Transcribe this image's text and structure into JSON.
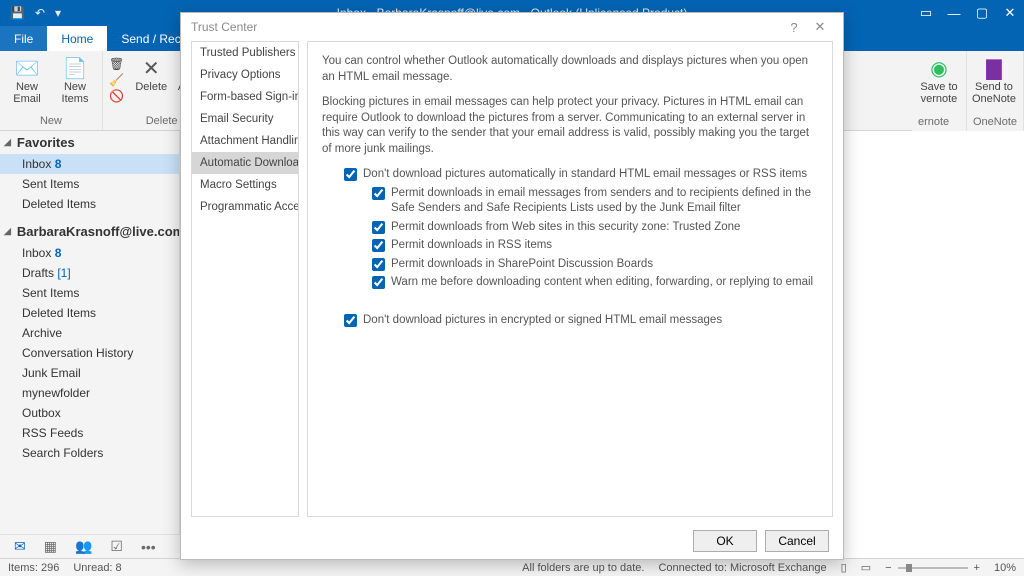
{
  "titlebar": {
    "title": "Inbox - BarbaraKrasnoff@live.com - Outlook (Unlicensed Product)"
  },
  "tabs": {
    "file": "File",
    "home": "Home",
    "sendreceive": "Send / Receive"
  },
  "ribbon": {
    "new_email": "New\nEmail",
    "new_items": "New\nItems",
    "delete": "Delete",
    "archive": "Archive",
    "group_new": "New",
    "group_delete": "Delete",
    "save_evernote": "Save to\nvernote",
    "send_onenote": "Send to\nOneNote",
    "group_evernote": "ernote",
    "group_onenote": "OneNote"
  },
  "folderpane": {
    "favorites": "Favorites",
    "fav_items": [
      {
        "label": "Inbox",
        "count": "8",
        "sel": true
      },
      {
        "label": "Sent Items"
      },
      {
        "label": "Deleted Items"
      }
    ],
    "account": "BarbaraKrasnoff@live.com",
    "acc_items": [
      {
        "label": "Inbox",
        "count": "8"
      },
      {
        "label": "Drafts",
        "bracket": "[1]"
      },
      {
        "label": "Sent Items"
      },
      {
        "label": "Deleted Items"
      },
      {
        "label": "Archive"
      },
      {
        "label": "Conversation History"
      },
      {
        "label": "Junk Email"
      },
      {
        "label": "mynewfolder"
      },
      {
        "label": "Outbox"
      },
      {
        "label": "RSS Feeds"
      },
      {
        "label": "Search Folders"
      }
    ]
  },
  "statusbar": {
    "items": "Items: 296",
    "unread": "Unread: 8",
    "uptodate": "All folders are up to date.",
    "connected": "Connected to: Microsoft Exchange",
    "zoom": "10%"
  },
  "dialog": {
    "title": "Trust Center",
    "side": [
      "Trusted Publishers",
      "Privacy Options",
      "Form-based Sign-in",
      "Email Security",
      "Attachment Handling",
      "Automatic Download",
      "Macro Settings",
      "Programmatic Access"
    ],
    "side_selected": 5,
    "intro": "You can control whether Outlook automatically downloads and displays pictures when you open an HTML email message.",
    "blurb": "Blocking pictures in email messages can help protect your privacy. Pictures in HTML email can require Outlook to download the pictures from a server. Communicating to an external server in this way can verify to the sender that your email address is valid, possibly making you the target of more junk mailings.",
    "chk_main": "Don't download pictures automatically in standard HTML email messages or RSS items",
    "chk_sub": [
      "Permit downloads in email messages from senders and to recipients defined in the Safe Senders and Safe Recipients Lists used by the Junk Email filter",
      "Permit downloads from Web sites in this security zone: Trusted Zone",
      "Permit downloads in RSS items",
      "Permit downloads in SharePoint Discussion Boards",
      "Warn me before downloading content when editing, forwarding, or replying to email"
    ],
    "chk_encrypted": "Don't download pictures in encrypted or signed HTML email messages",
    "ok": "OK",
    "cancel": "Cancel"
  }
}
